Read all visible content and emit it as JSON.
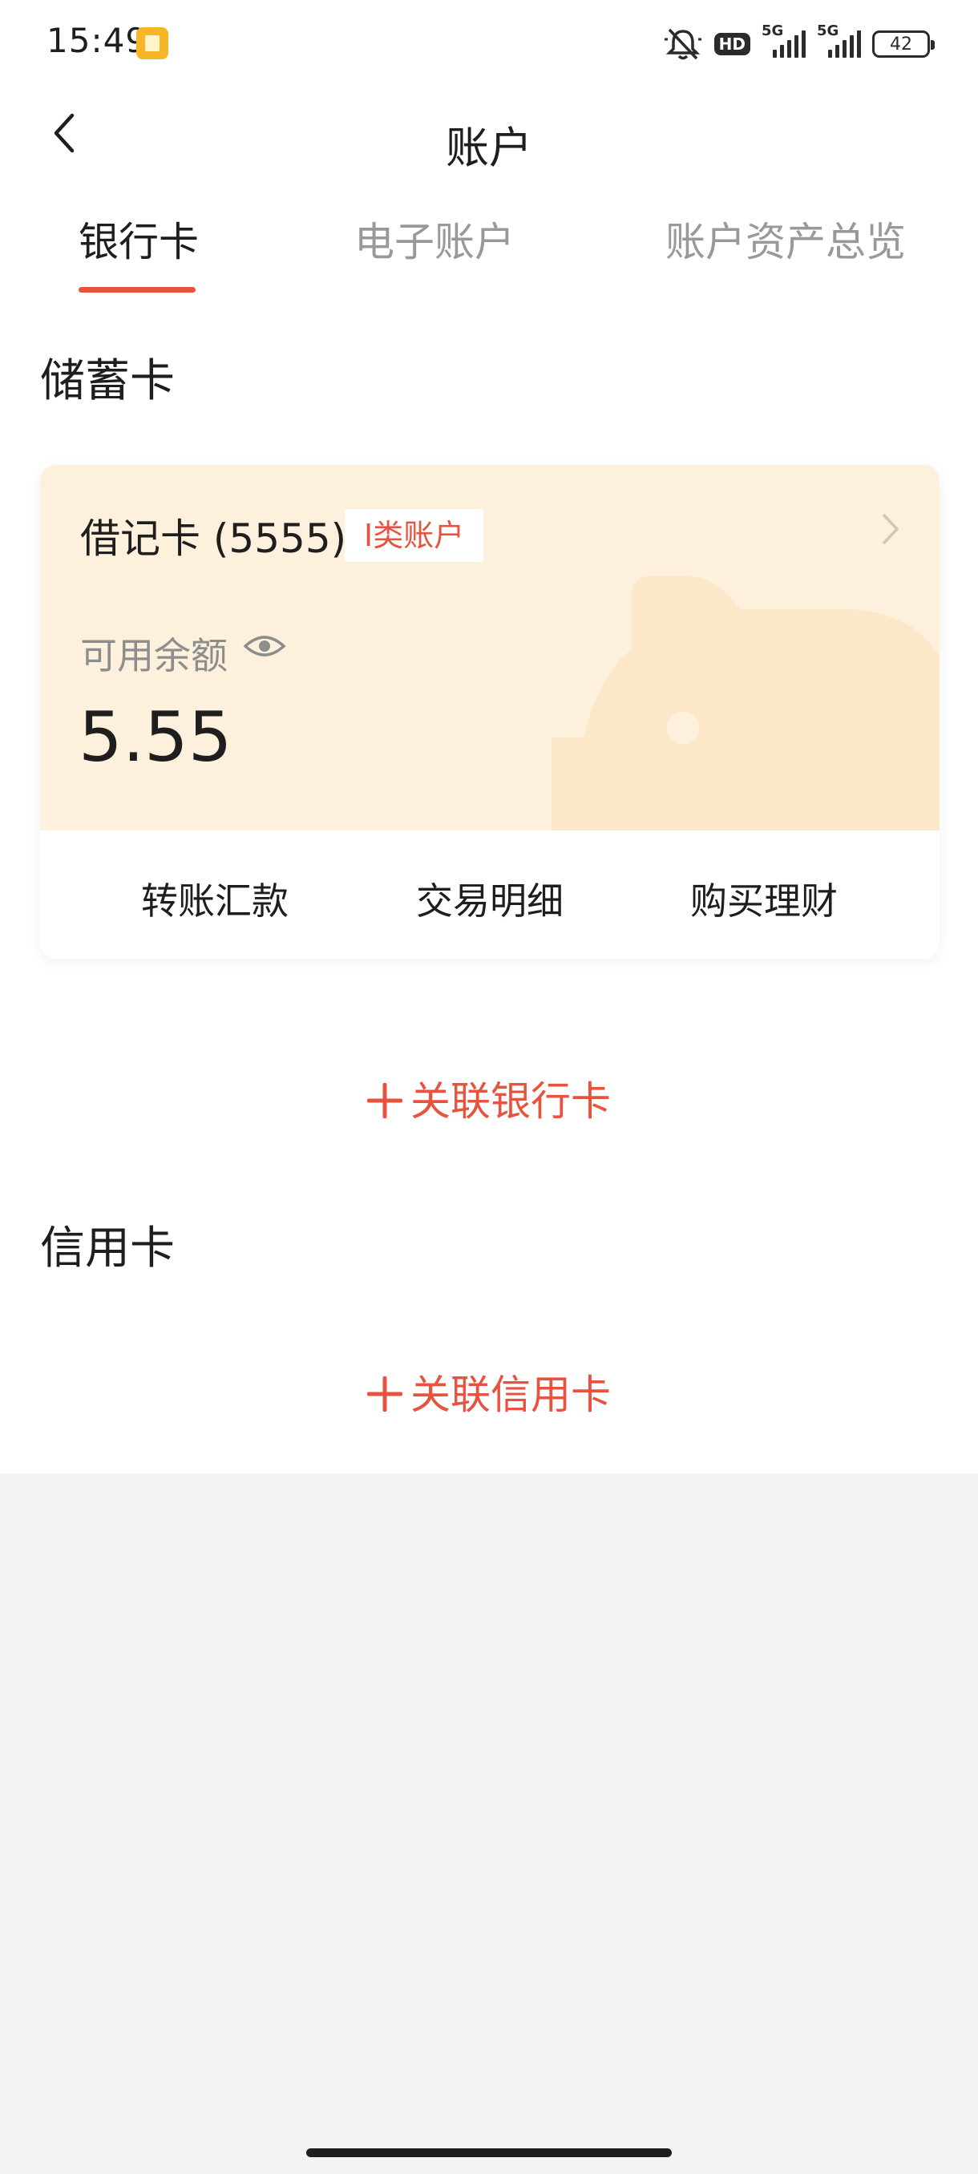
{
  "status_bar": {
    "time": "15:49",
    "network_1": "5G",
    "network_2": "5G",
    "hd_label": "HD",
    "battery": "42"
  },
  "header": {
    "title": "账户",
    "back_icon": "chevron-left-icon"
  },
  "tabs": [
    {
      "label": "银行卡",
      "active": true
    },
    {
      "label": "电子账户",
      "active": false
    },
    {
      "label": "账户资产总览",
      "active": false
    }
  ],
  "savings": {
    "section_title": "储蓄卡",
    "card": {
      "name": "借记卡 (5555)",
      "badge": "Ⅰ类账户",
      "balance_label": "可用余额",
      "balance": "5.55",
      "actions": [
        "转账汇款",
        "交易明细",
        "购买理财"
      ]
    },
    "link_label": "关联银行卡"
  },
  "credit": {
    "section_title": "信用卡",
    "link_label": "关联信用卡"
  },
  "colors": {
    "accent": "#e8533f",
    "card_bg": "#fdf1dd",
    "page_bg": "#f2f2f2"
  }
}
